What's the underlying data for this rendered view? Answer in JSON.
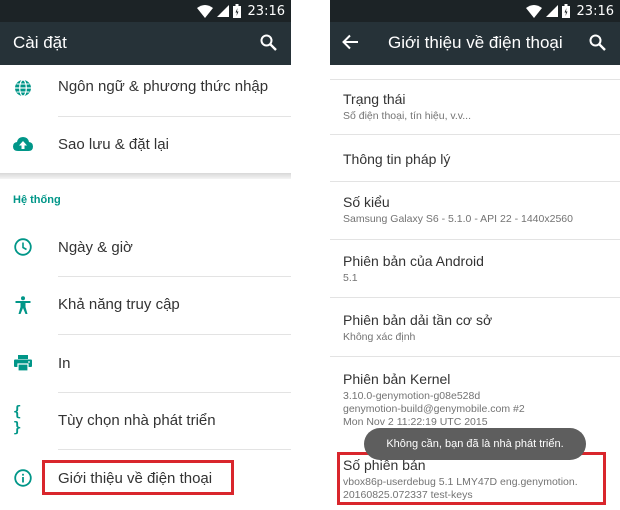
{
  "status_bar": {
    "time": "23:16",
    "icons": [
      "wifi-icon",
      "cell-signal-icon",
      "battery-icon"
    ]
  },
  "left_screen": {
    "title": "Cài đặt",
    "items_top": [
      {
        "label": "Ngôn ngữ & phương thức nhập",
        "icon": "globe-icon"
      },
      {
        "label": "Sao lưu & đặt lại",
        "icon": "cloud-upload-icon"
      }
    ],
    "section_title": "Hệ thống",
    "items_system": [
      {
        "label": "Ngày & giờ",
        "icon": "clock-icon"
      },
      {
        "label": "Khả năng truy cập",
        "icon": "accessibility-icon"
      },
      {
        "label": "In",
        "icon": "printer-icon"
      },
      {
        "label": "Tùy chọn nhà phát triển",
        "icon": "code-braces-icon"
      },
      {
        "label": "Giới thiệu về điện thoại",
        "icon": "info-icon"
      }
    ]
  },
  "right_screen": {
    "title": "Giới thiệu về điện thoại",
    "items": [
      {
        "title": "Trạng thái",
        "subtitle": [
          "Số điện thoại, tín hiệu, v.v..."
        ]
      },
      {
        "title": "Thông tin pháp lý",
        "subtitle": []
      },
      {
        "title": "Số kiểu",
        "subtitle": [
          "Samsung Galaxy S6 - 5.1.0 - API 22 - 1440x2560"
        ]
      },
      {
        "title": "Phiên bản của Android",
        "subtitle": [
          "5.1"
        ]
      },
      {
        "title": "Phiên bản dải tần cơ sở",
        "subtitle": [
          "Không xác định"
        ]
      },
      {
        "title": "Phiên bản Kernel",
        "subtitle": [
          "3.10.0-genymotion-g08e528d",
          "genymotion-build@genymobile.com #2",
          "Mon Nov 2 11:22:19 UTC 2015"
        ]
      },
      {
        "title": "Số phiên bản",
        "subtitle": [
          "vbox86p-userdebug 5.1 LMY47D eng.genymotion.",
          "20160825.072337 test-keys"
        ]
      }
    ],
    "toast": "Không cần, bạn đã là nhà phát triển."
  },
  "colors": {
    "app_bar": "#263238",
    "status_bar": "#1c2326",
    "accent": "#009688",
    "highlight": "#d9262c"
  }
}
